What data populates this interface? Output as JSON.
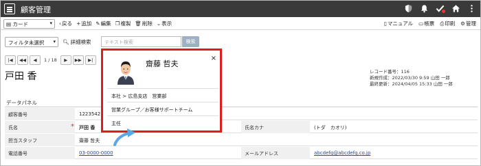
{
  "header": {
    "title": "顧客管理",
    "icons": [
      "shield-icon",
      "bell-icon",
      "check-icon",
      "home-icon",
      "more-vertical-icon"
    ]
  },
  "toolbar": {
    "view_select": "カード",
    "back": "戻る",
    "add": "追加",
    "edit": "編集",
    "copy": "複製",
    "delete": "削除",
    "display": "表示",
    "manual": "マニュアル",
    "form": "帳票",
    "print": "印刷",
    "admin": "管理"
  },
  "filter": {
    "select_value": "フィルタ未選択",
    "advanced_search": "詳細検索",
    "text_placeholder": "テキスト検索",
    "search_button": "検索"
  },
  "pager": {
    "info": "1 / 18"
  },
  "record": {
    "name": "戸田 香",
    "record_no": "レコード番号：116",
    "created": "新規作成：2022/03/30 9:59 山田 一郎",
    "updated": "最終更新：2024/04/05 15:33 山田 一郎"
  },
  "panel": {
    "title": "データパネル",
    "rows": [
      {
        "label": "顧客番号",
        "value": "1223542"
      },
      {
        "label": "氏名",
        "value": "戸田 香",
        "label2": "氏名カナ",
        "value2": "(トダ　カオリ)"
      },
      {
        "label": "担当スタッフ",
        "value": "齋藤 哲夫"
      },
      {
        "label": "電話番号",
        "value": "03-0000-0000",
        "label2": "メールアドレス",
        "value2": "abcdefg@abcdefg.co.jp"
      }
    ],
    "required_mark": "*"
  },
  "popup": {
    "name": "齋藤 哲夫",
    "close": "×",
    "office": "本社 > 広島支店　営業部",
    "group": "営業グループ／お客様サポートチーム",
    "position": "主任"
  },
  "colors": {
    "header_bg": "#3a3a3a",
    "popup_border": "#e01b1b",
    "arrow": "#5ea6e6",
    "required": "#e03030"
  }
}
